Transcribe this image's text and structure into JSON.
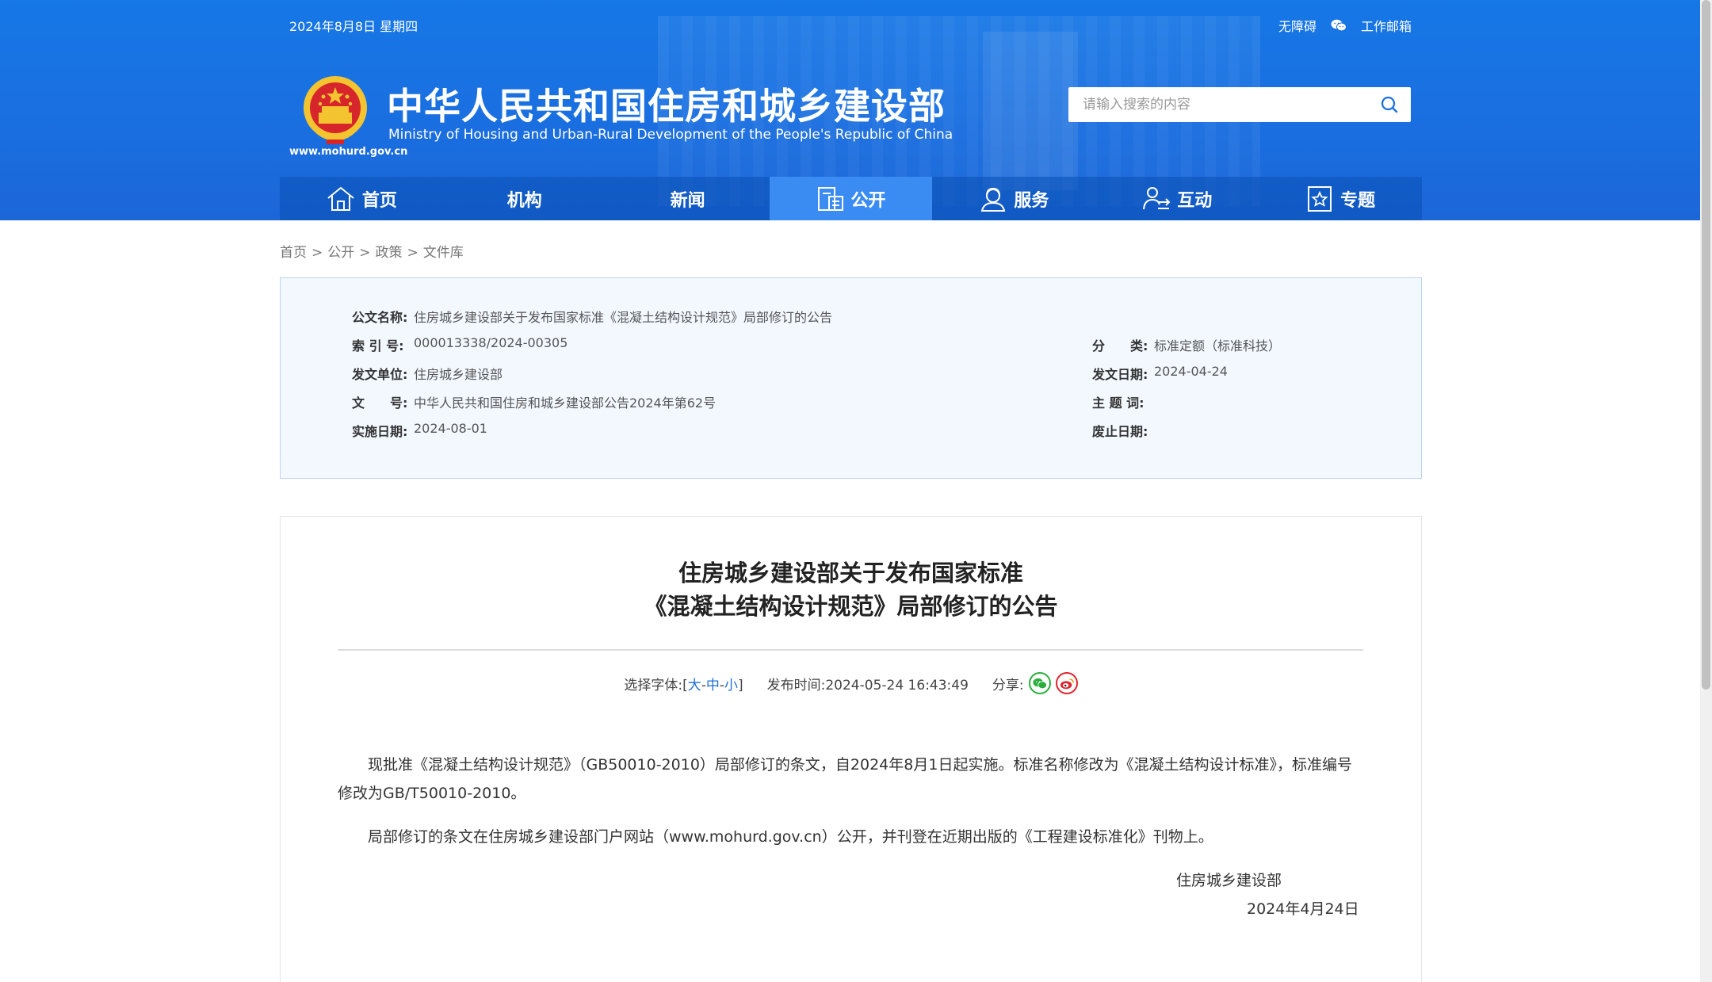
{
  "header": {
    "date": "2024年8月8日 星期四",
    "accessibility_link": "无障碍",
    "mail_link": "工作邮箱",
    "site_title": "中华人民共和国住房和城乡建设部",
    "site_subtitle": "Ministry of Housing and Urban-Rural Development of the People's Republic of China",
    "site_url": "www.mohurd.gov.cn",
    "search_placeholder": "请输入搜索的内容"
  },
  "nav": {
    "items": [
      {
        "label": "首页",
        "icon": "home-icon"
      },
      {
        "label": "机构",
        "icon": ""
      },
      {
        "label": "新闻",
        "icon": ""
      },
      {
        "label": "公开",
        "icon": "document-icon",
        "active": true
      },
      {
        "label": "服务",
        "icon": "service-icon"
      },
      {
        "label": "互动",
        "icon": "interact-icon"
      },
      {
        "label": "专题",
        "icon": "topic-icon"
      }
    ]
  },
  "breadcrumb": [
    "首页",
    "公开",
    "政策",
    "文件库"
  ],
  "meta": {
    "doc_name_key": "公文名称:",
    "doc_name": "住房城乡建设部关于发布国家标准《混凝土结构设计规范》局部修订的公告",
    "index_key": "索 引 号:",
    "index": "000013338/2024-00305",
    "category_key": "分　　类:",
    "category": "标准定额（标准科技）",
    "issuer_key": "发文单位:",
    "issuer": "住房城乡建设部",
    "issue_date_key": "发文日期:",
    "issue_date": "2024-04-24",
    "doc_no_key": "文　　号:",
    "doc_no": "中华人民共和国住房和城乡建设部公告2024年第62号",
    "keywords_key": "主 题 词:",
    "keywords": "",
    "effective_key": "实施日期:",
    "effective": "2024-08-01",
    "repeal_key": "废止日期:",
    "repeal": ""
  },
  "article": {
    "title_line1": "住房城乡建设部关于发布国家标准",
    "title_line2": "《混凝土结构设计规范》局部修订的公告",
    "font_select_label": "选择字体:",
    "font_large": "大",
    "font_medium": "中",
    "font_small": "小",
    "pub_time_label": "发布时间:",
    "pub_time": "2024-05-24 16:43:49",
    "share_label": "分享:",
    "para1": "现批准《混凝土结构设计规范》（GB50010-2010）局部修订的条文，自2024年8月1日起实施。标准名称修改为《混凝土结构设计标准》，标准编号修改为GB/T50010-2010。",
    "para2": "局部修订的条文在住房城乡建设部门户网站（www.mohurd.gov.cn）公开，并刊登在近期出版的《工程建设标准化》刊物上。",
    "signature": "住房城乡建设部",
    "sign_date": "2024年4月24日"
  },
  "colors": {
    "header_blue": "#1a6fe0",
    "nav_active": "#3b8cf2",
    "link_blue": "#1f6fd6",
    "meta_bg": "#f3f8ff"
  }
}
